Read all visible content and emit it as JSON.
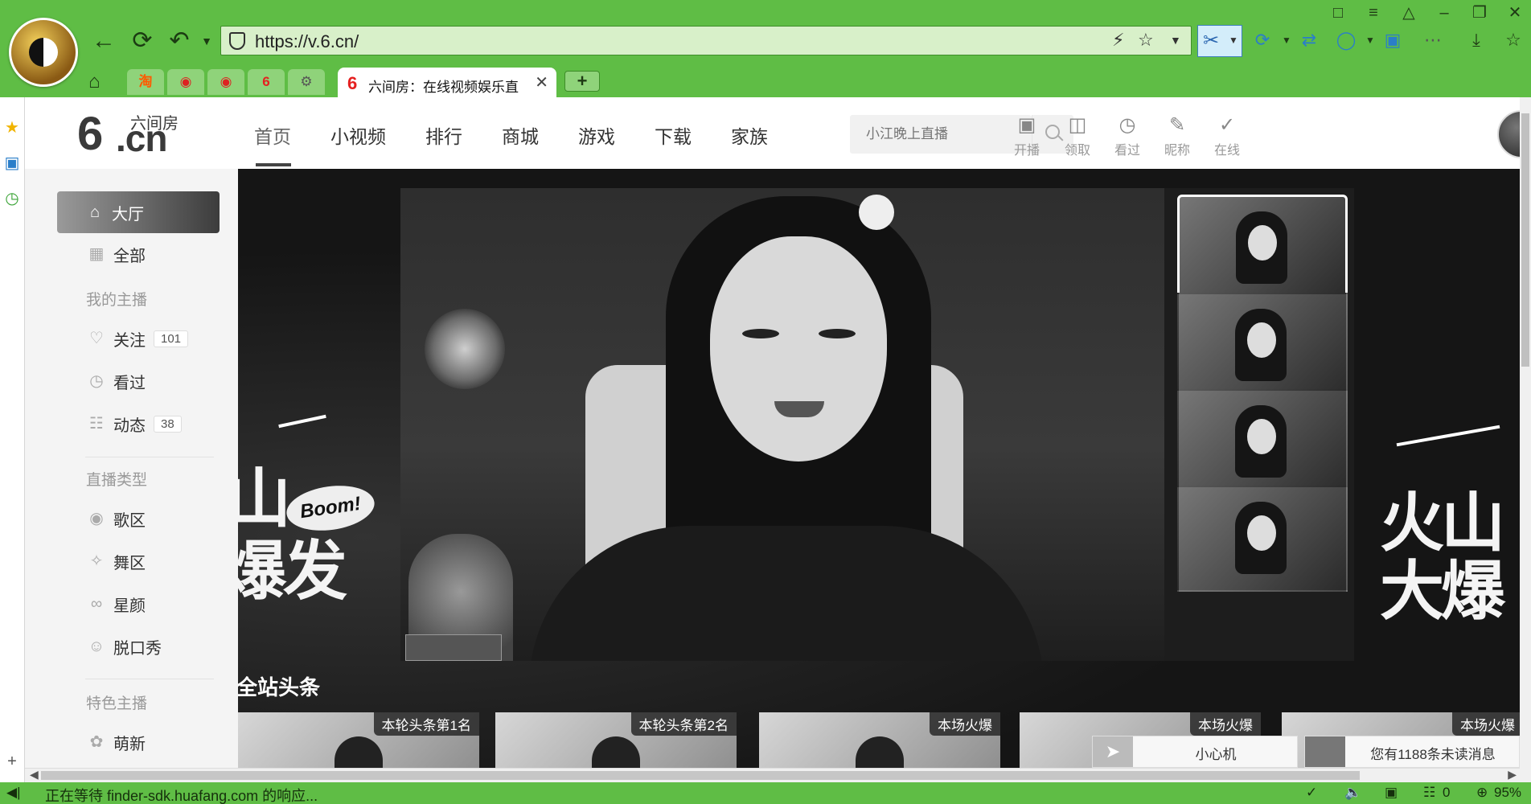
{
  "browser": {
    "url": "https://v.6.cn/",
    "active_tab_title": "六间房：在线视频娱乐直",
    "mini_tabs": [
      "淘",
      "",
      "",
      "6",
      "⚙"
    ],
    "zoom": "95%",
    "status_text": "正在等待 finder-sdk.huafang.com 的响应...",
    "status_counter": "0"
  },
  "site": {
    "brand_cn": "六间房",
    "brand_six": "6",
    "brand_dotcn": ".cn",
    "nav": [
      "首页",
      "小视频",
      "排行",
      "商城",
      "游戏",
      "下载",
      "家族"
    ],
    "search_placeholder": "小江晚上直播",
    "header_actions": [
      "开播",
      "领取",
      "看过",
      "昵称",
      "在线"
    ]
  },
  "sidebar": {
    "main": [
      "大厅",
      "全部"
    ],
    "my_anchors_title": "我的主播",
    "follow_label": "关注",
    "follow_count": "101",
    "watched_label": "看过",
    "feed_label": "动态",
    "feed_count": "38",
    "types_title": "直播类型",
    "types": [
      "歌区",
      "舞区",
      "星颜",
      "脱口秀"
    ],
    "featured_title": "特色主播",
    "featured": [
      "萌新"
    ]
  },
  "banner": {
    "left_art_line1": "山",
    "left_art_line2": "爆发",
    "boom_text": "Boom!",
    "right_art_line1": "火山",
    "right_art_line2": "大爆"
  },
  "headline_title": "全站头条",
  "cards": [
    {
      "badge": "本轮头条第1名"
    },
    {
      "badge": "本轮头条第2名"
    },
    {
      "badge": "本场火爆"
    },
    {
      "badge": "本场火爆"
    },
    {
      "badge": "本场火爆"
    }
  ],
  "chat": {
    "little_heart": "小心机",
    "unread": "您有1188条未读消息"
  }
}
